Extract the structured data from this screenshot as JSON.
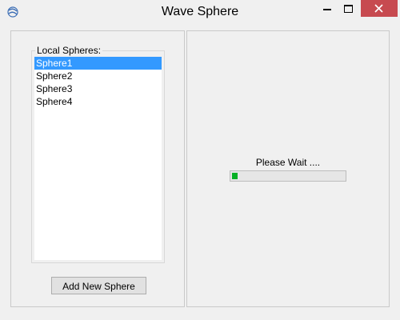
{
  "window": {
    "title": "Wave Sphere",
    "icon": "wave-sphere-app-icon",
    "controls": [
      "minimize-icon",
      "maximize-icon",
      "close-icon"
    ],
    "close_color": "#c74a50"
  },
  "spheres": {
    "group_label": "Local Spheres:",
    "items": [
      {
        "label": "Sphere1",
        "selected": true
      },
      {
        "label": "Sphere2",
        "selected": false
      },
      {
        "label": "Sphere3",
        "selected": false
      },
      {
        "label": "Sphere4",
        "selected": false
      }
    ],
    "selection_color": "#3399ff",
    "add_button_label": "Add New Sphere"
  },
  "status": {
    "message": "Please Wait ....",
    "progress_percent": 5,
    "progress_color": "#06b025"
  }
}
